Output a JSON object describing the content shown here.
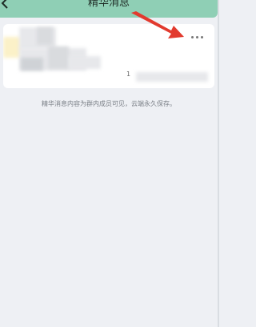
{
  "header": {
    "title": "精华消息",
    "back_icon": "back-arrow-icon"
  },
  "card": {
    "more_icon": "more-dots-icon",
    "count": "1"
  },
  "footer": {
    "note": "精华消息内容为群内成员可见，云端永久保存。"
  },
  "annotation": {
    "arrow_color": "#e23a2e"
  },
  "colors": {
    "topbar": "#8fcfb5",
    "background": "#eef0f4",
    "card": "#ffffff"
  }
}
